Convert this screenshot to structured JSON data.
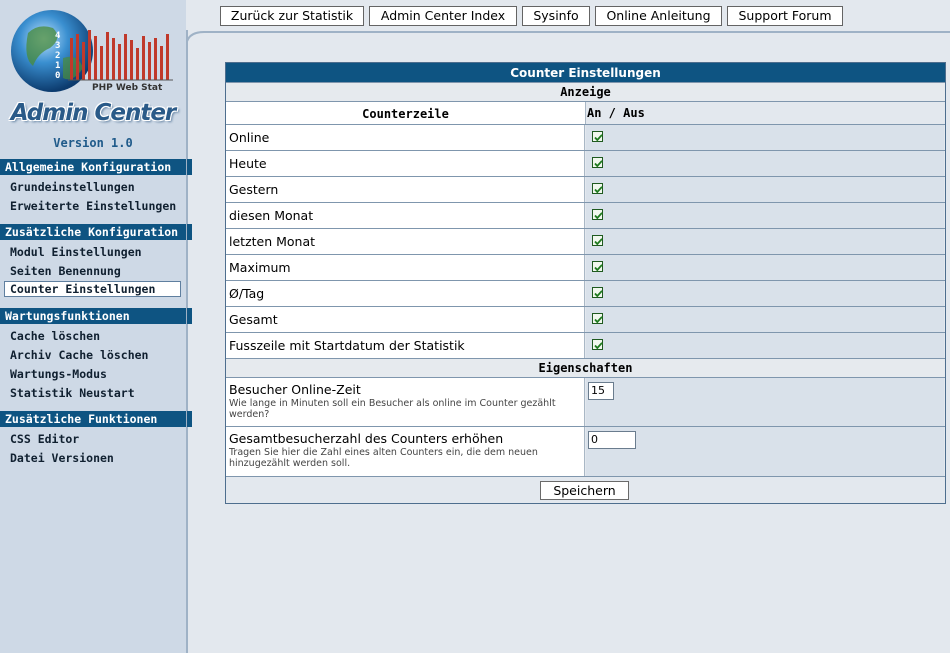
{
  "logo": {
    "text": "PHP Web Stat",
    "digits": [
      "4",
      "3",
      "2",
      "1",
      "0"
    ]
  },
  "app_title": "Admin Center",
  "version": "Version 1.0",
  "sidebar": {
    "sections": [
      {
        "title": "Allgemeine Konfiguration",
        "items": [
          "Grundeinstellungen",
          "Erweiterte Einstellungen"
        ]
      },
      {
        "title": "Zusätzliche Konfiguration",
        "items": [
          "Modul Einstellungen",
          "Seiten Benennung",
          "Counter Einstellungen"
        ]
      },
      {
        "title": "Wartungsfunktionen",
        "items": [
          "Cache löschen",
          "Archiv Cache löschen",
          "Wartungs-Modus",
          "Statistik Neustart"
        ]
      },
      {
        "title": "Zusätzliche Funktionen",
        "items": [
          "CSS Editor",
          "Datei Versionen"
        ]
      }
    ],
    "active_item": "Counter Einstellungen"
  },
  "topnav": [
    "Zurück zur Statistik",
    "Admin Center Index",
    "Sysinfo",
    "Online Anleitung",
    "Support Forum"
  ],
  "panel": {
    "title": "Counter Einstellungen",
    "section1": "Anzeige",
    "col1_header": "Counterzeile",
    "col2_header": "An / Aus",
    "rows": [
      {
        "label": "Online",
        "checked": true
      },
      {
        "label": "Heute",
        "checked": true
      },
      {
        "label": "Gestern",
        "checked": true
      },
      {
        "label": "diesen Monat",
        "checked": true
      },
      {
        "label": "letzten Monat",
        "checked": true
      },
      {
        "label": "Maximum",
        "checked": true
      },
      {
        "label": "Ø/Tag",
        "checked": true
      },
      {
        "label": "Gesamt",
        "checked": true
      },
      {
        "label": "Fusszeile mit Startdatum der Statistik",
        "checked": true
      }
    ],
    "section2": "Eigenschaften",
    "props": [
      {
        "label": "Besucher Online-Zeit",
        "desc": "Wie lange in Minuten soll ein Besucher als online im Counter gezählt werden?",
        "value": "15"
      },
      {
        "label": "Gesamtbesucherzahl des Counters erhöhen",
        "desc": "Tragen Sie hier die Zahl eines alten Counters ein, die dem neuen hinzugezählt werden soll.",
        "value": "0"
      }
    ],
    "save_label": "Speichern"
  },
  "colors": {
    "accent": "#0e5482",
    "sidebar_bg": "#ced9e6",
    "page_bg": "#e3e8ee",
    "check": "#1e7a1e"
  }
}
